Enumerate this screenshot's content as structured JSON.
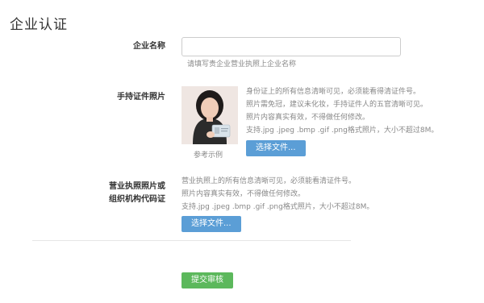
{
  "page": {
    "title": "企业认证"
  },
  "company_name": {
    "label": "企业名称",
    "value": "",
    "hint": "请填写贵企业营业执照上企业名称"
  },
  "id_photo": {
    "label": "手持证件照片",
    "caption": "参考示例",
    "instructions": [
      "身份证上的所有信息清晰可见，必须能看得清证件号。",
      "照片需免冠，建议未化妆，手持证件人的五官清晰可见。",
      "照片内容真实有效，不得做任何修改。",
      "支持.jpg .jpeg .bmp .gif .png格式照片，大小不超过8M。"
    ],
    "button": "选择文件..."
  },
  "license_photo": {
    "label_lines": [
      "营业执照照片或",
      "组织机构代码证"
    ],
    "instructions": [
      "营业执照上的所有信息清晰可见，必须能看清证件号。",
      "照片内容真实有效，不得做任何修改。",
      "支持.jpg .jpeg .bmp .gif .png格式照片，大小不超过8M。"
    ],
    "button": "选择文件..."
  },
  "submit": {
    "label": "提交审核"
  },
  "colors": {
    "file_button": "#5b9ed6",
    "submit_button": "#5cb85c"
  }
}
